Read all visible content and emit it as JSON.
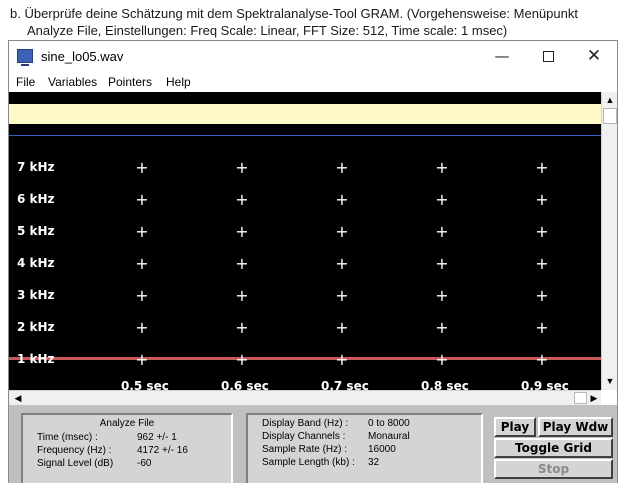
{
  "instruction": {
    "line1": "b. Überprüfe deine Schätzung mit dem Spektralanalyse-Tool GRAM. (Vorgehensweise: Menüpunkt",
    "line2": "Analyze File, Einstellungen: Freq Scale: Linear, FFT Size: 512, Time scale: 1 msec)"
  },
  "window": {
    "title": "sine_lo05.wav",
    "controls": {
      "minimize": "—",
      "close": "✕"
    }
  },
  "menu": [
    "File",
    "Variables",
    "Pointers",
    "Help"
  ],
  "display": {
    "freq_labels": [
      "7 kHz",
      "6 kHz",
      "5 kHz",
      "4 kHz",
      "3 kHz",
      "2 kHz",
      "1 kHz"
    ],
    "time_labels": [
      "0.5 sec",
      "0.6 sec",
      "0.7 sec",
      "0.8 sec",
      "0.9 sec"
    ],
    "grid_marker": "+",
    "colors": {
      "background": "#000000",
      "band_strip": "#fff8c8",
      "trace": "#c85a5a",
      "separator": "#3a5fc8"
    }
  },
  "scrollbars": {
    "up": "▲",
    "down": "▼",
    "left": "◀",
    "right": "▶"
  },
  "analyze_panel": {
    "title": "Analyze File",
    "rows": [
      {
        "label": "Time (msec) :",
        "value": "962  +/- 1"
      },
      {
        "label": "Frequency (Hz) :",
        "value": "4172 +/- 16"
      },
      {
        "label": "Signal Level (dB)",
        "value": "-60"
      }
    ]
  },
  "display_panel": {
    "rows": [
      {
        "label": "Display Band (Hz) :",
        "value": "0 to 8000"
      },
      {
        "label": "Display Channels :",
        "value": "Monaural"
      },
      {
        "label": "Sample Rate (Hz) :",
        "value": "16000"
      },
      {
        "label": "Sample Length (kb) :",
        "value": "32"
      }
    ]
  },
  "buttons": {
    "play": "Play",
    "play_wdw": "Play Wdw",
    "toggle_grid": "Toggle Grid",
    "stop": "Stop"
  }
}
